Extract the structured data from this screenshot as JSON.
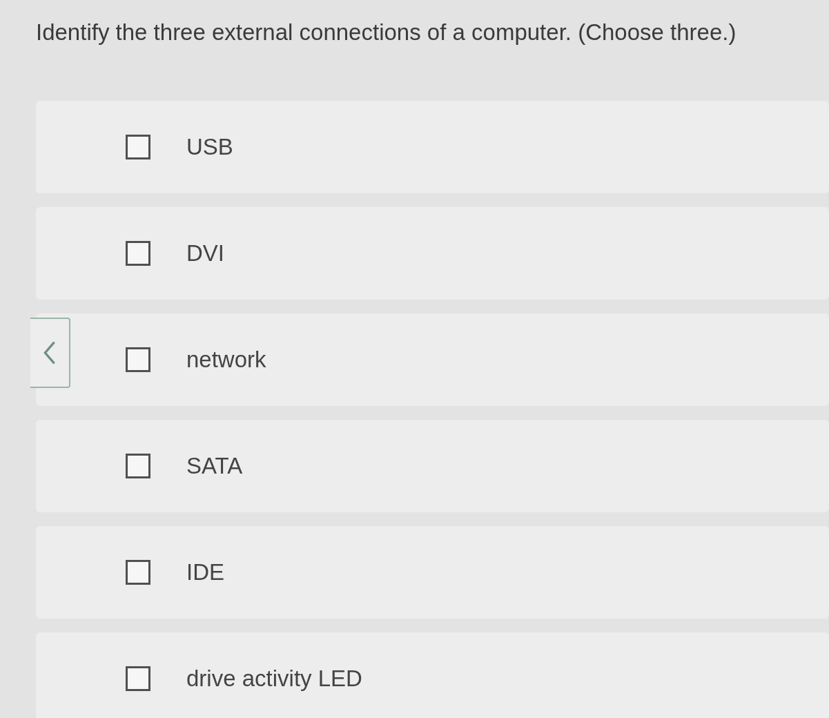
{
  "question": "Identify the three external connections of a computer. (Choose three.)",
  "options": [
    {
      "label": "USB",
      "checked": false
    },
    {
      "label": "DVI",
      "checked": false
    },
    {
      "label": "network",
      "checked": false
    },
    {
      "label": "SATA",
      "checked": false
    },
    {
      "label": "IDE",
      "checked": false
    },
    {
      "label": "drive activity LED",
      "checked": false
    }
  ]
}
